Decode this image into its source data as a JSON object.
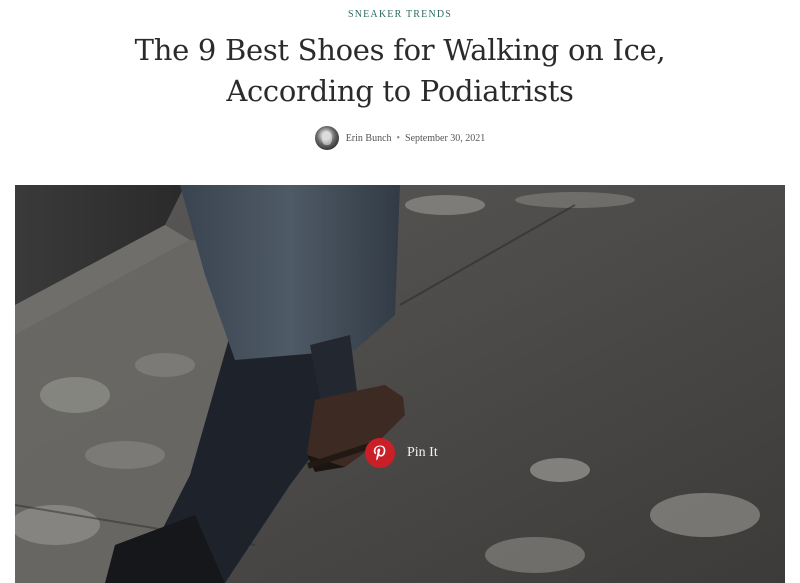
{
  "article": {
    "category": "SNEAKER TRENDS",
    "title": "The 9 Best Shoes for Walking on Ice, According to Podiatrists",
    "author": "Erin Bunch",
    "separator": "•",
    "date": "September 30, 2021"
  },
  "hero": {
    "pin_label": "Pin It",
    "pin_color": "#cb1f27"
  },
  "colors": {
    "category": "#2f6b63",
    "title": "#2b2b2b"
  }
}
